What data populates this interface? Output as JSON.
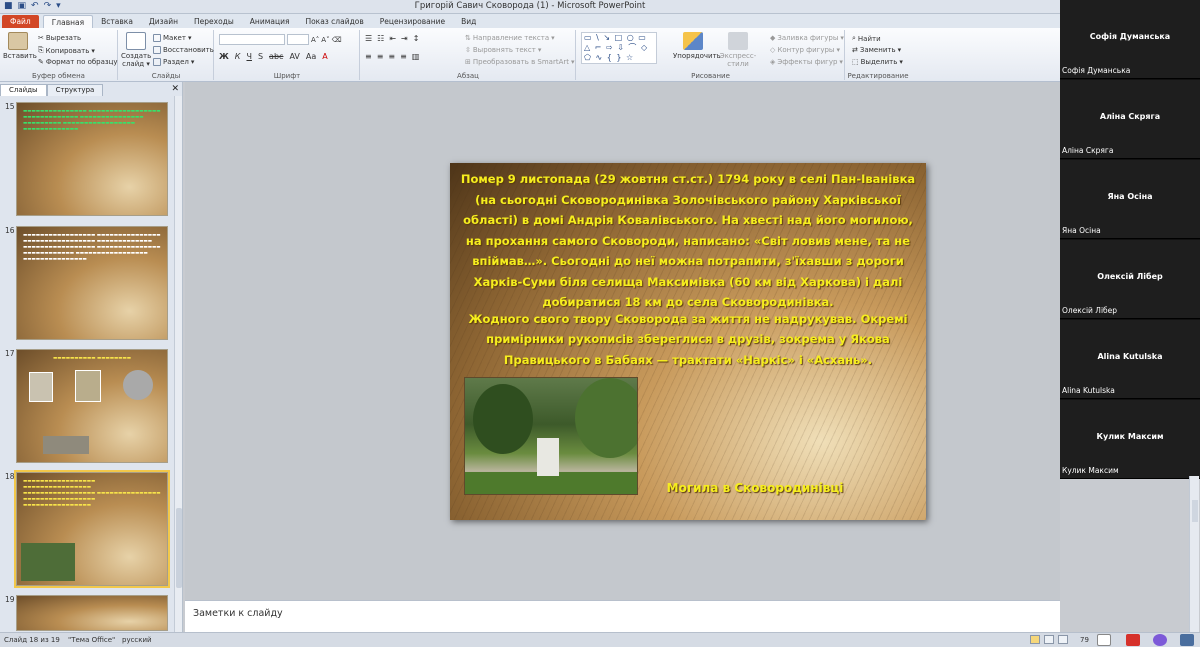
{
  "window": {
    "title": "Григорій Савич Сковорода (1) - Microsoft PowerPoint"
  },
  "tabs": [
    "Файл",
    "Главная",
    "Вставка",
    "Дизайн",
    "Переходы",
    "Анимация",
    "Показ слайдов",
    "Рецензирование",
    "Вид"
  ],
  "active_tab": "Главная",
  "ribbon": {
    "clipboard": {
      "paste": "Вставить",
      "cut": "Вырезать",
      "copy": "Копировать",
      "format": "Формат по образцу",
      "label": "Буфер обмена"
    },
    "slides": {
      "new": "Создать слайд",
      "layout": "Макет",
      "reset": "Восстановить",
      "section": "Раздел",
      "label": "Слайды"
    },
    "font": {
      "label": "Шрифт"
    },
    "paragraph": {
      "dir": "Направление текста",
      "align": "Выровнять текст",
      "smartart": "Преобразовать в SmartArt",
      "label": "Абзац"
    },
    "drawing": {
      "arrange": "Упорядочить",
      "styles": "Экспресс-стили",
      "fill": "Заливка фигуры",
      "outline": "Контур фигуры",
      "effects": "Эффекты фигур",
      "label": "Рисование"
    },
    "editing": {
      "find": "Найти",
      "replace": "Заменить",
      "select": "Выделить",
      "label": "Редактирование"
    }
  },
  "left_panel": {
    "tabs": [
      "Слайды",
      "Структура"
    ],
    "slides": [
      {
        "number": "15"
      },
      {
        "number": "16"
      },
      {
        "number": "17"
      },
      {
        "number": "18"
      },
      {
        "number": "19"
      }
    ]
  },
  "slide": {
    "text_p1": "Помер 9 листопада (29 жовтня ст.ст.) 1794 року в селі Пан-Іванівка (на сьогодні Сковородинівка Золочівського району Харківської області) в домі Андрія Ковалівського. На хвесті над його могилою, на прохання самого Сковороди, написано: «Світ ловив мене, та не впіймав…». Сьогодні до неї можна потрапити, з'їхавши з дороги Харків-Суми біля селища Максимівка (60 км від Харкова) і далі добиратися 18 км до села Сковородинівка.",
    "text_p2": "Жодного свого твору Сковорода за життя не надрукував. Окремі примірники рукописів збереглися в друзів, зокрема у Якова Правицького в Бабаях — трактати «Наркіс» і «Асхань».",
    "caption": "Могила в Сковородинівці"
  },
  "notes": {
    "placeholder": "Заметки к слайду"
  },
  "status": {
    "slide": "Слайд 18 из 19",
    "theme": "\"Тема Office\"",
    "lang": "русский",
    "zoom": "79"
  },
  "participants": [
    {
      "name": "Софія Думанська",
      "label": "Софія Думанська"
    },
    {
      "name": "Аліна Скряга",
      "label": "Аліна Скряга"
    },
    {
      "name": "Яна Осіна",
      "label": "Яна Осіна"
    },
    {
      "name": "Олексій Лібер",
      "label": "Олексій Лібер"
    },
    {
      "name": "Alina Kutulska",
      "label": "Alina Kutulska"
    },
    {
      "name": "Кулик Максим",
      "label": "Кулик Максим"
    }
  ],
  "colors": {
    "slide_text": "#f6ee1e",
    "file_tab": "#d24726",
    "thumb_selected": "#f2c84a"
  }
}
